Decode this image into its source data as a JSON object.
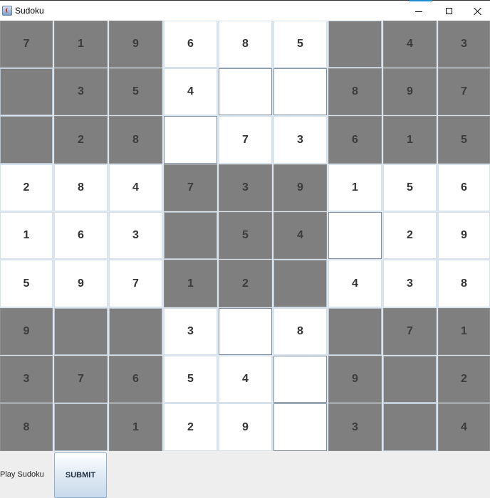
{
  "window": {
    "title": "Sudoku",
    "icon": "java-app-icon",
    "controls": [
      "minimize-icon",
      "maximize-icon",
      "close-icon"
    ]
  },
  "colors": {
    "given": "#7f7f7f",
    "empty": "#ffffff",
    "text": "#333333"
  },
  "board": {
    "rows": [
      [
        {
          "v": "7",
          "g": true
        },
        {
          "v": "1",
          "g": true
        },
        {
          "v": "9",
          "g": true
        },
        {
          "v": "6",
          "g": false
        },
        {
          "v": "8",
          "g": false
        },
        {
          "v": "5",
          "g": false
        },
        {
          "v": "",
          "g": true
        },
        {
          "v": "4",
          "g": true
        },
        {
          "v": "3",
          "g": true
        }
      ],
      [
        {
          "v": "",
          "g": true
        },
        {
          "v": "3",
          "g": true
        },
        {
          "v": "5",
          "g": true
        },
        {
          "v": "4",
          "g": false
        },
        {
          "v": "",
          "g": false
        },
        {
          "v": "",
          "g": false
        },
        {
          "v": "8",
          "g": true
        },
        {
          "v": "9",
          "g": true
        },
        {
          "v": "7",
          "g": true
        }
      ],
      [
        {
          "v": "",
          "g": true
        },
        {
          "v": "2",
          "g": true
        },
        {
          "v": "8",
          "g": true
        },
        {
          "v": "",
          "g": false
        },
        {
          "v": "7",
          "g": false
        },
        {
          "v": "3",
          "g": false
        },
        {
          "v": "6",
          "g": true
        },
        {
          "v": "1",
          "g": true
        },
        {
          "v": "5",
          "g": true
        }
      ],
      [
        {
          "v": "2",
          "g": false
        },
        {
          "v": "8",
          "g": false
        },
        {
          "v": "4",
          "g": false
        },
        {
          "v": "7",
          "g": true
        },
        {
          "v": "3",
          "g": true
        },
        {
          "v": "9",
          "g": true
        },
        {
          "v": "1",
          "g": false
        },
        {
          "v": "5",
          "g": false
        },
        {
          "v": "6",
          "g": false
        }
      ],
      [
        {
          "v": "1",
          "g": false
        },
        {
          "v": "6",
          "g": false
        },
        {
          "v": "3",
          "g": false
        },
        {
          "v": "",
          "g": true
        },
        {
          "v": "5",
          "g": true
        },
        {
          "v": "4",
          "g": true
        },
        {
          "v": "",
          "g": false
        },
        {
          "v": "2",
          "g": false
        },
        {
          "v": "9",
          "g": false
        }
      ],
      [
        {
          "v": "5",
          "g": false
        },
        {
          "v": "9",
          "g": false
        },
        {
          "v": "7",
          "g": false
        },
        {
          "v": "1",
          "g": true
        },
        {
          "v": "2",
          "g": true
        },
        {
          "v": "",
          "g": true
        },
        {
          "v": "4",
          "g": false
        },
        {
          "v": "3",
          "g": false
        },
        {
          "v": "8",
          "g": false
        }
      ],
      [
        {
          "v": "9",
          "g": true
        },
        {
          "v": "",
          "g": true
        },
        {
          "v": "",
          "g": true
        },
        {
          "v": "3",
          "g": false
        },
        {
          "v": "",
          "g": false
        },
        {
          "v": "8",
          "g": false
        },
        {
          "v": "",
          "g": true
        },
        {
          "v": "7",
          "g": true
        },
        {
          "v": "1",
          "g": true
        }
      ],
      [
        {
          "v": "3",
          "g": true
        },
        {
          "v": "7",
          "g": true
        },
        {
          "v": "6",
          "g": true
        },
        {
          "v": "5",
          "g": false
        },
        {
          "v": "4",
          "g": false
        },
        {
          "v": "",
          "g": false
        },
        {
          "v": "9",
          "g": true
        },
        {
          "v": "",
          "g": true
        },
        {
          "v": "2",
          "g": true
        }
      ],
      [
        {
          "v": "8",
          "g": true
        },
        {
          "v": "",
          "g": true
        },
        {
          "v": "1",
          "g": true
        },
        {
          "v": "2",
          "g": false
        },
        {
          "v": "9",
          "g": false
        },
        {
          "v": "",
          "g": false
        },
        {
          "v": "3",
          "g": true
        },
        {
          "v": "",
          "g": true
        },
        {
          "v": "4",
          "g": true
        }
      ]
    ]
  },
  "footer": {
    "status_label": "Play Sudoku",
    "submit_label": "SUBMIT"
  }
}
